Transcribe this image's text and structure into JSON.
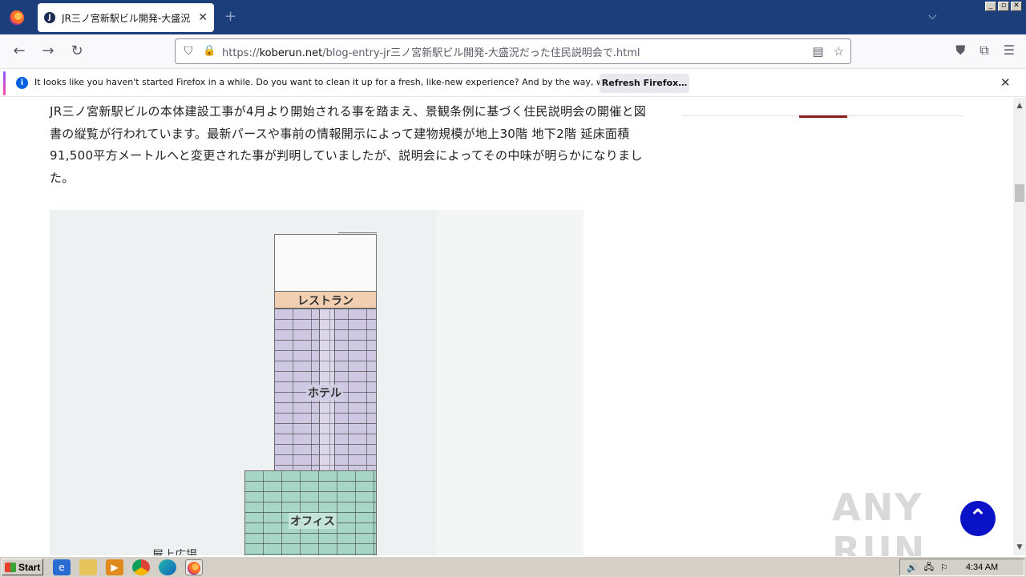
{
  "browser": {
    "tab": {
      "favicon_letter": "J",
      "title": "JR三ノ宮新駅ビル開発-大盛況だっ",
      "close_glyph": "✕"
    },
    "new_tab_glyph": "+",
    "tablist_glyph": "⌵",
    "window_controls": [
      "_",
      "▫",
      "✕"
    ],
    "nav": {
      "back_glyph": "←",
      "forward_glyph": "→",
      "reload_glyph": "↻"
    },
    "url": {
      "scheme": "https://",
      "host": "koberun.net",
      "path": "/blog-entry-jr三ノ宮新駅ビル開発-大盛況だった住民説明会で.html"
    },
    "url_icons": {
      "shield_glyph": "⛉",
      "lock_glyph": "🔒",
      "reader_glyph": "▤",
      "bookmark_glyph": "☆"
    },
    "toolbar_glyphs": {
      "pocket": "⛊",
      "extensions": "⧉",
      "menu": "☰"
    }
  },
  "notification": {
    "text": "It looks like you haven't started Firefox in a while. Do you want to clean it up for a fresh, like-new experience? And by the way, welcome back!",
    "button_label": "Refresh Firefox…",
    "close_glyph": "✕"
  },
  "article": {
    "paragraph": "JR三ノ宮新駅ビルの本体建設工事が4月より開始される事を踏まえ、景観条例に基づく住民説明会の開催と図書の縦覧が行われています。最新パースや事前の情報開示によって建物規模が地上30階 地下2階 延床面積91,500平方メートルへと変更された事が判明していましたが、説明会によってその中味が明らかになりました。",
    "figure_labels": {
      "restaurant": "レストラン",
      "hotel": "ホテル",
      "office": "オフィス",
      "plaza": "屋上広場"
    }
  },
  "page_extras": {
    "watermark": "ANY RUN",
    "scroll_top_glyph": "⌃",
    "scroll_up": "▲",
    "scroll_down": "▼"
  },
  "taskbar": {
    "start_label": "Start",
    "time": "4:34 AM",
    "tray_glyphs": [
      "🔊",
      "🖧",
      "⚐"
    ]
  },
  "colors": {
    "titlebar": "#1c3f7c",
    "restaurant_band": "#f2cfb0",
    "hotel_band": "#cfc8e2",
    "office_band": "#a8d6c6",
    "scroll_top_button": "#0a12c8"
  }
}
